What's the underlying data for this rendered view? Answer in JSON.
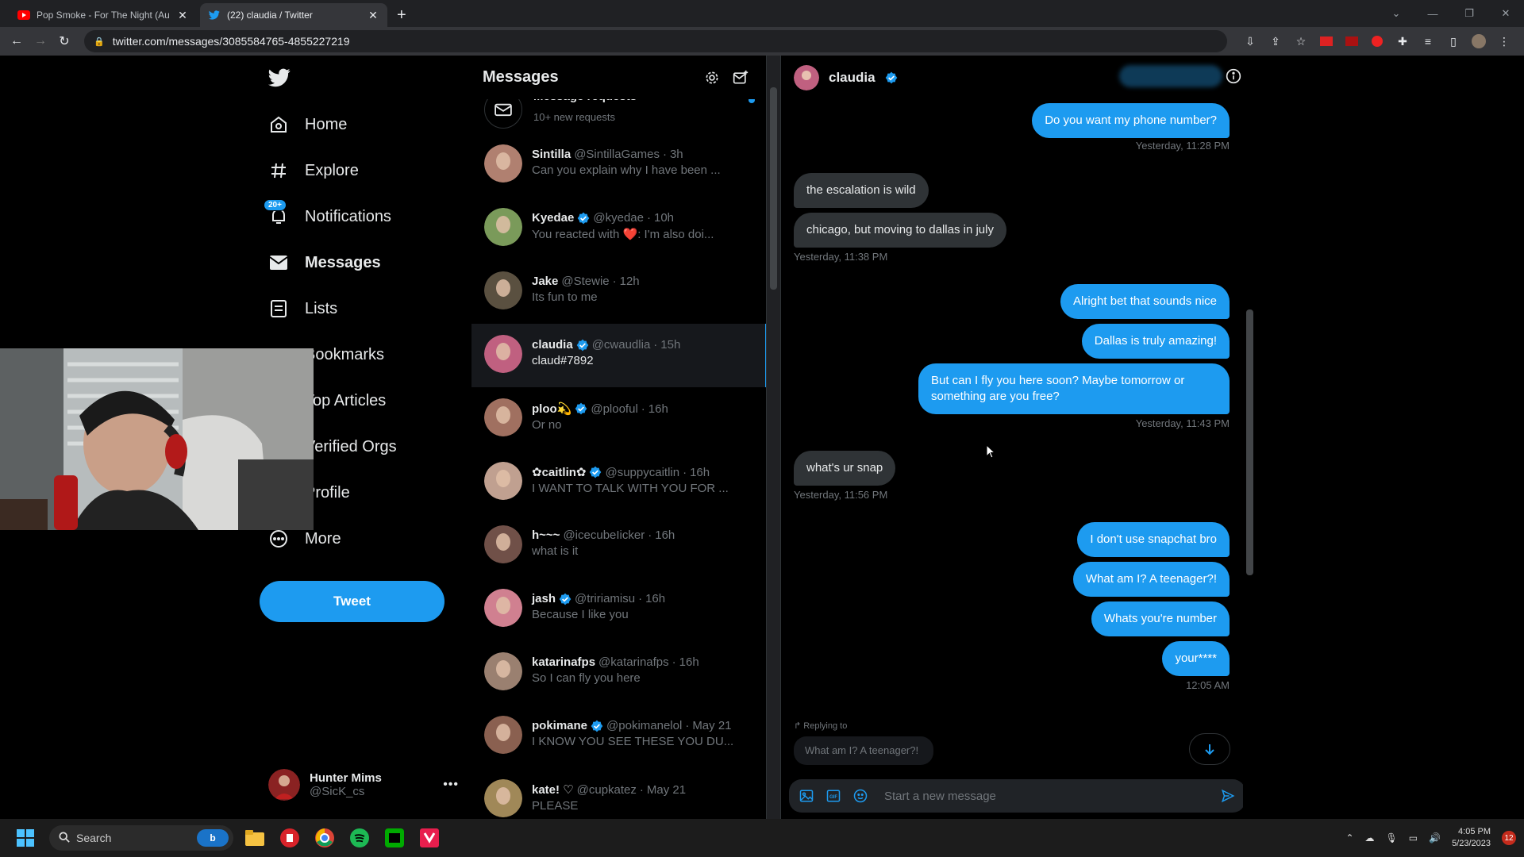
{
  "browser": {
    "tabs": [
      {
        "title": "Pop Smoke - For The Night (Aud",
        "icon": "youtube-icon",
        "active": false
      },
      {
        "title": "(22) claudia / Twitter",
        "icon": "twitter-icon",
        "active": true
      }
    ],
    "url": "twitter.com/messages/3085584765-4855227219"
  },
  "nav": {
    "items": [
      {
        "label": "Home",
        "icon": "home-icon"
      },
      {
        "label": "Explore",
        "icon": "hashtag-icon"
      },
      {
        "label": "Notifications",
        "icon": "bell-icon",
        "badge": "20+"
      },
      {
        "label": "Messages",
        "icon": "mail-icon"
      },
      {
        "label": "Lists",
        "icon": "list-icon"
      },
      {
        "label": "Bookmarks",
        "icon": "bookmark-icon"
      },
      {
        "label": "Top Articles",
        "icon": "articles-icon"
      },
      {
        "label": "Verified Orgs",
        "icon": "verified-orgs-icon"
      },
      {
        "label": "Profile",
        "icon": "profile-icon"
      },
      {
        "label": "More",
        "icon": "more-icon"
      }
    ],
    "tweet_button": "Tweet",
    "account": {
      "name": "Hunter Mims",
      "handle": "@SicK_cs"
    }
  },
  "messages": {
    "title": "Messages",
    "requests": {
      "label": "Message requests",
      "sub": "10+ new requests"
    },
    "conversations": [
      {
        "name": "Sintilla",
        "handle": "@SintillaGames",
        "time": "3h",
        "preview": "Can you explain why I have been ...",
        "verified": false,
        "color": "#b08070"
      },
      {
        "name": "Kyedae",
        "handle": "@kyedae",
        "time": "10h",
        "preview": "You reacted with ❤️: I'm also doi...",
        "verified": true,
        "color": "#7a9a5a"
      },
      {
        "name": "Jake",
        "handle": "@Stewie",
        "time": "12h",
        "preview": "Its fun to me",
        "verified": false,
        "color": "#5a5040"
      },
      {
        "name": "claudia",
        "handle": "@cwaudlia",
        "time": "15h",
        "preview": "claud#7892",
        "verified": true,
        "color": "#c06080",
        "active": true
      },
      {
        "name": "ploo💫",
        "handle": "@plooful",
        "time": "16h",
        "preview": "Or no",
        "verified": true,
        "color": "#a07060"
      },
      {
        "name": "✿caitlin✿",
        "handle": "@suppycaitlin",
        "time": "16h",
        "preview": "I WANT TO TALK WITH YOU FOR ...",
        "verified": true,
        "color": "#c0a090"
      },
      {
        "name": "h~~~",
        "handle": "@icecubeIicker",
        "time": "16h",
        "preview": "what is it",
        "verified": false,
        "color": "#705048"
      },
      {
        "name": "jash",
        "handle": "@tririamisu",
        "time": "16h",
        "preview": "Because I like you",
        "verified": true,
        "color": "#d08090"
      },
      {
        "name": "katarinafps",
        "handle": "@katarinafps",
        "time": "16h",
        "preview": "So I can fly you here",
        "verified": false,
        "color": "#9a8070"
      },
      {
        "name": "pokimane",
        "handle": "@pokimanelol",
        "time": "May 21",
        "preview": "I KNOW YOU SEE THESE YOU DU...",
        "verified": true,
        "color": "#8a6050"
      },
      {
        "name": "kate! ♡",
        "handle": "@cupkatez",
        "time": "May 21",
        "preview": "PLEASE",
        "verified": false,
        "color": "#a08858"
      }
    ]
  },
  "chat": {
    "name": "claudia",
    "messages": [
      {
        "text": "Do you want my phone number?",
        "from": "me"
      },
      {
        "text": "the escalation is wild",
        "from": "them"
      },
      {
        "text": "chicago, but moving to dallas in july",
        "from": "them"
      },
      {
        "text": "Alright bet that sounds nice",
        "from": "me"
      },
      {
        "text": "Dallas is truly amazing!",
        "from": "me"
      },
      {
        "text": "But can I fly you here soon? Maybe tomorrow or something are you free?",
        "from": "me"
      },
      {
        "text": "what's ur snap",
        "from": "them"
      },
      {
        "text": "I don't use snapchat bro",
        "from": "me"
      },
      {
        "text": "What am I? A teenager?!",
        "from": "me"
      },
      {
        "text": "Whats you're number",
        "from": "me"
      },
      {
        "text": "your****",
        "from": "me"
      }
    ],
    "timestamps": [
      "Yesterday, 11:28 PM",
      "Yesterday, 11:38 PM",
      "Yesterday, 11:43 PM",
      "Yesterday, 11:56 PM",
      "12:05 AM"
    ],
    "replying_to": "Replying to",
    "reply_quote": "What am I? A teenager?!",
    "placeholder": "Start a new message"
  },
  "taskbar": {
    "search_label": "Search",
    "time": "4:05 PM",
    "date": "5/23/2023",
    "notifications": "12"
  },
  "colors": {
    "accent": "#1d9bf0",
    "background": "#000000",
    "bubble_them": "#2f3336"
  }
}
